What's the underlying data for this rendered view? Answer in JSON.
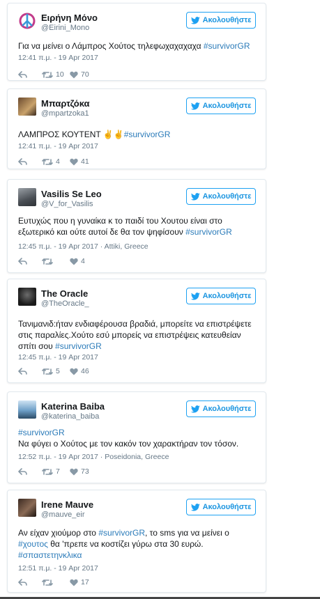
{
  "follow_label": "Ακολουθήστε",
  "colors": {
    "accent": "#1da1f2",
    "link": "#2b7bb9",
    "muted": "#657786"
  },
  "tweets": [
    {
      "name": "Ειρήνη Μόνο",
      "handle": "@Eirini_Mono",
      "avatar_icon": "peace-sign-icon",
      "text_parts": [
        {
          "t": "Για να μείνει ο Λάμπρος Χούτος τηλεφωχαχαχαχα ",
          "link": false
        },
        {
          "t": "#survivorGR",
          "link": true
        }
      ],
      "meta": "12:41 π.μ. - 19 Apr 2017",
      "retweets": "10",
      "likes": "70"
    },
    {
      "name": "Μπαρτζόκα",
      "handle": "@mpartzoka1",
      "avatar_icon": "profile-photo",
      "text_parts": [
        {
          "t": "ΛΑΜΠΡΟΣ ΚΟΥΤΕΝΤ ✌✌",
          "link": false
        },
        {
          "t": "#survivorGR",
          "link": true
        }
      ],
      "meta": "12:41 π.μ. - 19 Apr 2017",
      "retweets": "4",
      "likes": "41"
    },
    {
      "name": "Vasilis Se Leo",
      "handle": "@V_for_Vasilis",
      "avatar_icon": "profile-photo",
      "text_parts": [
        {
          "t": "Ευτυχώς που η γυναίκα κ το παιδί του Χουτου είναι στο εξωτερικό και ούτε αυτοί δε θα τον ψηφίσουν ",
          "link": false
        },
        {
          "t": "#survivorGR",
          "link": true
        }
      ],
      "meta": "12:45 π.μ. - 19 Apr 2017 · Attiki, Greece",
      "retweets": "",
      "likes": "4"
    },
    {
      "name": "The Oracle",
      "handle": "@TheOracle_",
      "avatar_icon": "profile-photo",
      "text_parts": [
        {
          "t": "Τανιμανιδ:ήταν ενδιαφέρουσα βραδιά, μπορείτε να επιστρέψετε στις παραλίες.Χούτο εσύ μπορείς να επιστρέψεις κατευθείαν σπίτι σου ",
          "link": false
        },
        {
          "t": "#survivorGR",
          "link": true
        }
      ],
      "meta": "12:45 π.μ. - 19 Apr 2017",
      "retweets": "5",
      "likes": "46"
    },
    {
      "name": "Katerina Baiba",
      "handle": "@katerina_baiba",
      "avatar_icon": "profile-photo",
      "text_parts": [
        {
          "t": "#survivorGR",
          "link": true,
          "br_after": true
        },
        {
          "t": "Να φύγει ο Χούτος με τον κακόν τον χαρακτήραν τον τόσον.",
          "link": false
        }
      ],
      "meta": "12:52 π.μ. - 19 Apr 2017 · Poseidonia, Greece",
      "retweets": "7",
      "likes": "73"
    },
    {
      "name": "Irene Mauve",
      "handle": "@mauve_eir",
      "avatar_icon": "profile-photo",
      "text_parts": [
        {
          "t": "Αν είχαν χιούμορ στο ",
          "link": false
        },
        {
          "t": "#survivorGR",
          "link": true
        },
        {
          "t": ", το sms για να μείνει ο ",
          "link": false
        },
        {
          "t": "#χουτος",
          "link": true
        },
        {
          "t": " θα 'πρεπε να κοστίζει γύρω στα 30 ευρώ. ",
          "link": false
        },
        {
          "t": "#σπαστετηνκλικα",
          "link": true
        }
      ],
      "meta": "12:51 π.μ. - 19 Apr 2017",
      "retweets": "",
      "likes": "17"
    }
  ]
}
